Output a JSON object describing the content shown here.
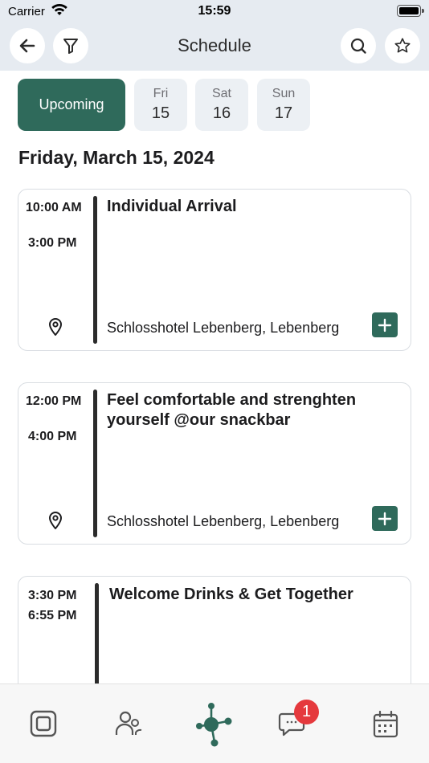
{
  "status_bar": {
    "carrier": "Carrier",
    "time": "15:59"
  },
  "nav": {
    "title": "Schedule",
    "icons": {
      "back": "arrow-left-icon",
      "filter": "funnel-icon",
      "search": "search-icon",
      "favorite": "star-icon"
    }
  },
  "date_tabs": {
    "upcoming_label": "Upcoming",
    "days": [
      {
        "dow": "Fri",
        "num": "15"
      },
      {
        "dow": "Sat",
        "num": "16"
      },
      {
        "dow": "Sun",
        "num": "17"
      }
    ]
  },
  "day_heading": "Friday, March 15, 2024",
  "events": [
    {
      "start": "10:00 AM",
      "end": "3:00 PM",
      "title": "Individual Arrival",
      "location": "Schlosshotel Lebenberg, Lebenberg"
    },
    {
      "start": "12:00 PM",
      "end": "4:00 PM",
      "title": "Feel comfortable and strenghten yourself @our snackbar",
      "location": "Schlosshotel Lebenberg, Lebenberg"
    },
    {
      "start": "3:30 PM",
      "end": "6:55 PM",
      "title": "Welcome Drinks & Get Together",
      "location": ""
    }
  ],
  "tab_bar": {
    "items": [
      "square-icon",
      "people-icon",
      "network-hub-icon",
      "chat-bubble-icon",
      "calendar-icon"
    ],
    "chat_badge": "1"
  },
  "colors": {
    "accent": "#2f6a5b",
    "header_bg": "#e6ebf1",
    "badge": "#e5393d"
  }
}
